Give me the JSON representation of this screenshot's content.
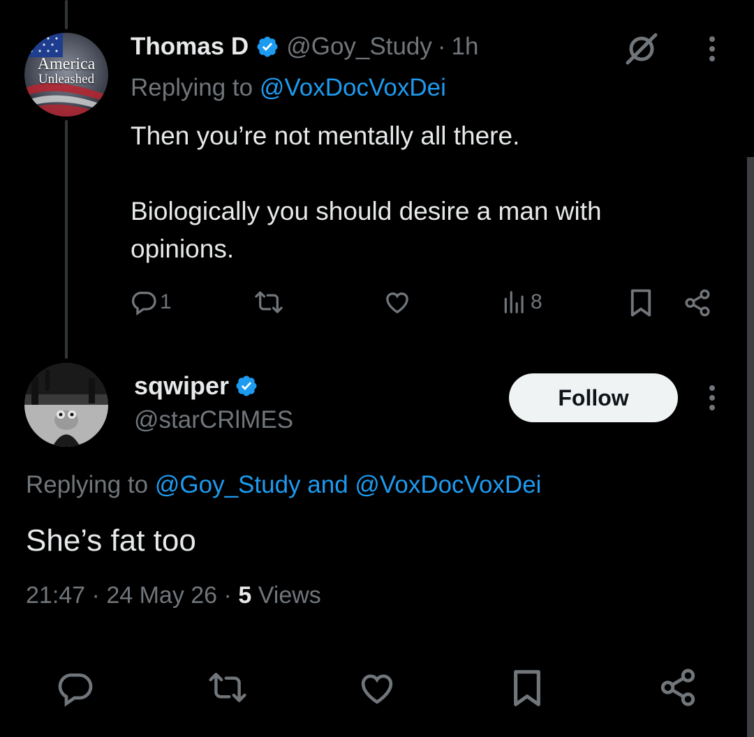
{
  "reply_tweet": {
    "display_name": "Thomas D",
    "handle": "@Goy_Study",
    "separator": "·",
    "time_ago": "1h",
    "replying_prefix": "Replying to",
    "replying_to": "@VoxDocVoxDei",
    "text_line1": "Then you’re not mentally all there.",
    "text_line2": "Biologically you should desire a man with",
    "text_line3": "opinions.",
    "avatar_text_top": "America",
    "avatar_text_bottom": "Unleashed",
    "actions": {
      "reply_count": "1",
      "views_count": "8"
    }
  },
  "main_tweet": {
    "display_name": "sqwiper",
    "handle": "@starCRlMES",
    "follow_label": "Follow",
    "replying_prefix": "Replying to",
    "replying_to_1": "@Goy_Study",
    "replying_and": "and",
    "replying_to_2": "@VoxDocVoxDei",
    "text": "She’s fat too",
    "time": "21:47",
    "date": "24 May 26",
    "views_count": "5",
    "views_label": "Views",
    "dot": "·"
  },
  "colors": {
    "background": "#000000",
    "text": "#e7e9ea",
    "secondary": "#71767b",
    "link": "#1d9bf0",
    "verified": "#1d9bf0"
  },
  "icons": [
    "grok-icon",
    "more-icon",
    "reply-icon",
    "retweet-icon",
    "like-icon",
    "views-icon",
    "bookmark-icon",
    "share-icon",
    "verified-badge-icon"
  ]
}
